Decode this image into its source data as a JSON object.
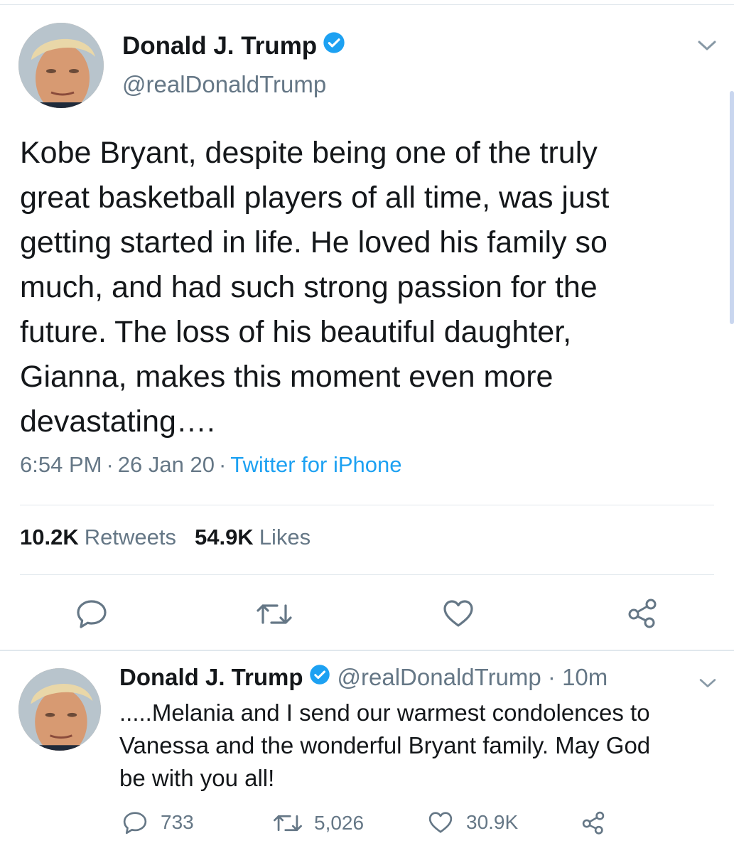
{
  "main_tweet": {
    "author_name": "Donald J. Trump",
    "handle": "@realDonaldTrump",
    "text": "Kobe Bryant, despite being one of the truly\ngreat basketball players of all time, was just\ngetting started in life. He loved his family so\nmuch, and had such strong passion for the\nfuture. The loss of his beautiful daughter,\nGianna, makes this moment even more\ndevastating….",
    "time": "6:54 PM",
    "date": "26 Jan 20",
    "source": "Twitter for iPhone",
    "retweets_count": "10.2K",
    "retweets_label": "Retweets",
    "likes_count": "54.9K",
    "likes_label": "Likes"
  },
  "reply_tweet": {
    "author_name": "Donald J. Trump",
    "handle_time": "@realDonaldTrump · 10m",
    "text": ".....Melania and I send our warmest condolences to\nVanessa and the wonderful Bryant family. May God\nbe with you all!",
    "reply_count": "733",
    "retweet_count": "5,026",
    "like_count": "30.9K"
  },
  "icons": [
    "verified-badge-icon",
    "chevron-down-icon",
    "reply-icon",
    "retweet-icon",
    "like-icon",
    "share-icon"
  ],
  "colors": {
    "accent": "#1da1f2",
    "secondary_text": "#657786",
    "divider": "#e1e8ed"
  }
}
